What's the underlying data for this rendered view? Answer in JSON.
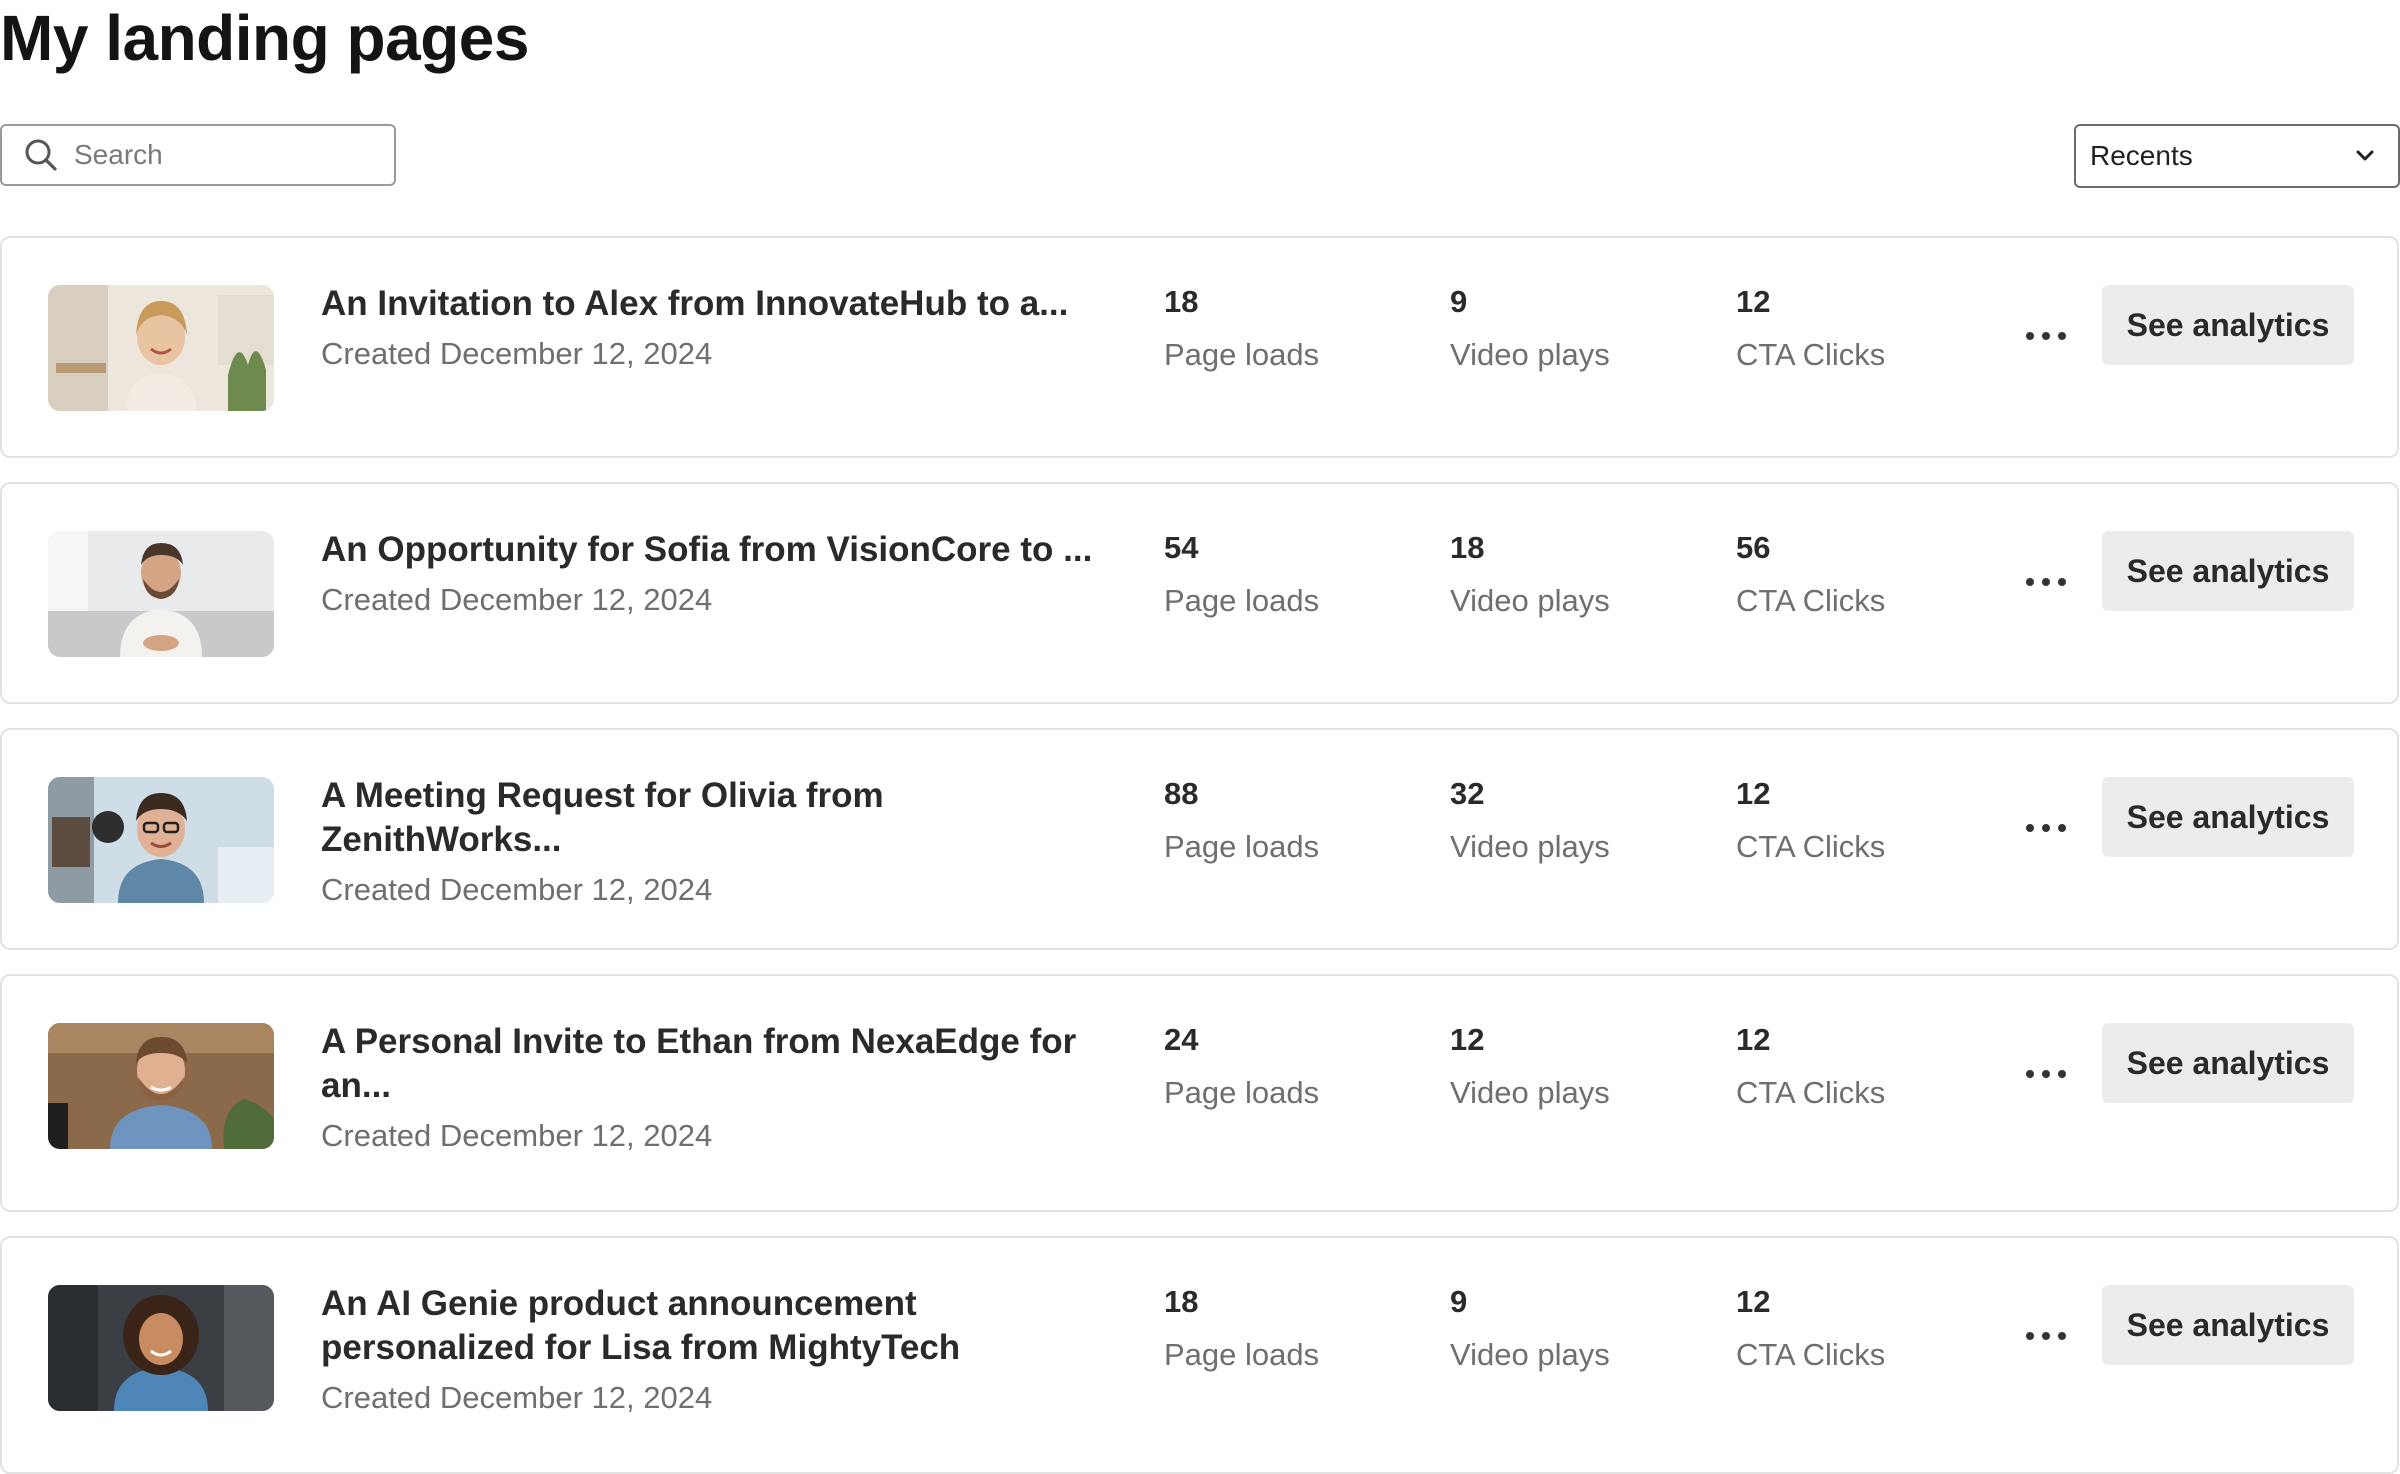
{
  "page": {
    "title": "My landing pages"
  },
  "search": {
    "placeholder": "Search",
    "icon": "search-icon"
  },
  "sort": {
    "selected": "Recents",
    "icon": "chevron-down-icon"
  },
  "stat_labels": {
    "page_loads": "Page loads",
    "video_plays": "Video plays",
    "cta_clicks": "CTA Clicks"
  },
  "actions": {
    "see_analytics": "See analytics",
    "more_icon": "more-horizontal-icon"
  },
  "pages": [
    {
      "title": "An Invitation to Alex from InnovateHub to a...",
      "created": "Created December 12, 2024",
      "page_loads": "18",
      "video_plays": "9",
      "cta_clicks": "12",
      "thumbnail": "smiling woman with blonde hair, bright room"
    },
    {
      "title": "An Opportunity for Sofia from VisionCore to ...",
      "created": "Created December 12, 2024",
      "page_loads": "54",
      "video_plays": "18",
      "cta_clicks": "56",
      "thumbnail": "bearded man in white t-shirt on couch"
    },
    {
      "title": "A Meeting Request for Olivia from ZenithWorks...",
      "created": "Created December 12, 2024",
      "page_loads": "88",
      "video_plays": "32",
      "cta_clicks": "12",
      "thumbnail": "man with glasses in denim shirt, office"
    },
    {
      "title": "A Personal Invite to Ethan from NexaEdge for an...",
      "created": "Created December 12, 2024",
      "page_loads": "24",
      "video_plays": "12",
      "cta_clicks": "12",
      "thumbnail": "smiling bearded man in blue shirt, wooden interior"
    },
    {
      "title": "An AI Genie product announcement personalized for Lisa from MightyTech",
      "created": "Created December 12, 2024",
      "page_loads": "18",
      "video_plays": "9",
      "cta_clicks": "12",
      "thumbnail": "curly-haired woman in denim shirt, dark room"
    }
  ]
}
